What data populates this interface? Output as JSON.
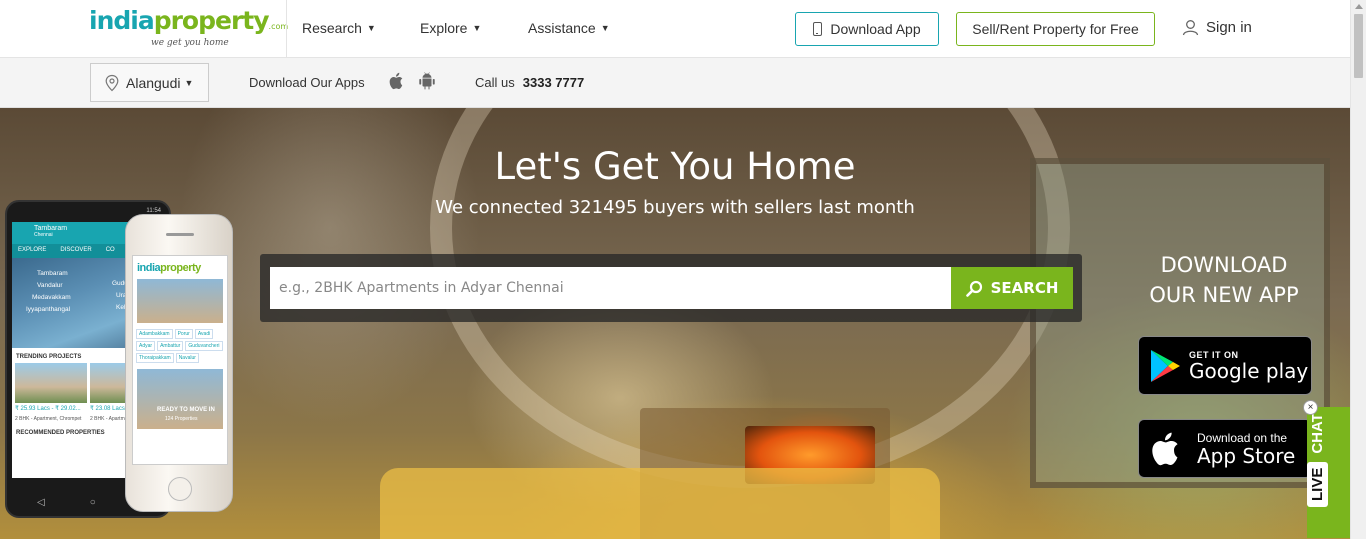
{
  "header": {
    "logo": {
      "india": "india",
      "property": "property",
      "dotcom": ".com",
      "tagline": "we get you home"
    },
    "nav": [
      {
        "label": "Research"
      },
      {
        "label": "Explore"
      },
      {
        "label": "Assistance"
      }
    ],
    "download_app_label": "Download App",
    "sell_rent_label": "Sell/Rent Property for Free",
    "signin_label": "Sign in"
  },
  "subbar": {
    "city": "Alangudi",
    "download_apps_label": "Download Our Apps",
    "call_label": "Call us",
    "call_number": "3333 7777"
  },
  "hero": {
    "title": "Let's Get You Home",
    "subtitle": "We connected 321495 buyers with sellers last month",
    "search_placeholder": "e.g., 2BHK Apartments in Adyar Chennai",
    "search_button": "SEARCH",
    "download_title_line1": "DOWNLOAD",
    "download_title_line2": "OUR NEW APP",
    "google_play": {
      "small": "GET IT ON",
      "big": "Google play"
    },
    "app_store": {
      "small": "Download on the",
      "big": "App Store"
    }
  },
  "live_chat": {
    "live": "LIVE",
    "chat": "CHAT",
    "close": "×"
  },
  "phone_android": {
    "appbar_title": "Tambaram",
    "appbar_sub": "Chennai",
    "tabs": [
      "EXPLORE",
      "DISCOVER",
      "CO"
    ],
    "map_labels": [
      "Tambaram",
      "Vandalur",
      "Medavakkam",
      "Iyyapanthangal",
      "Guduv",
      "Urapa",
      "Kelamb"
    ],
    "trending": "TRENDING PROJECTS",
    "price1": "₹ 25.93 Lacs - ₹ 29.02...",
    "price2": "₹ 23.08 Lacs",
    "desc1": "2 BHK - Apartment, Chrompet",
    "desc2": "2 BHK - Apartme Navalur",
    "recommended": "RECOMMENDED PROPERTIES",
    "time": "11:54"
  },
  "phone_iphone": {
    "logo_india": "india",
    "logo_property": "property",
    "chips": [
      "Adambakkam",
      "Porur",
      "Avadi",
      "Adyar",
      "Ambattur",
      "Guduvancheri",
      "Thoraipakkam",
      "Navalur"
    ],
    "ready": "READY TO MOVE IN",
    "count": "124 Properties"
  },
  "colors": {
    "brand_teal": "#18a5b0",
    "brand_green": "#7ab51d"
  },
  "icons": [
    "location-pin-icon",
    "apple-icon",
    "android-icon",
    "phone-icon",
    "user-icon",
    "search-icon",
    "google-play-icon",
    "apple-store-icon"
  ]
}
